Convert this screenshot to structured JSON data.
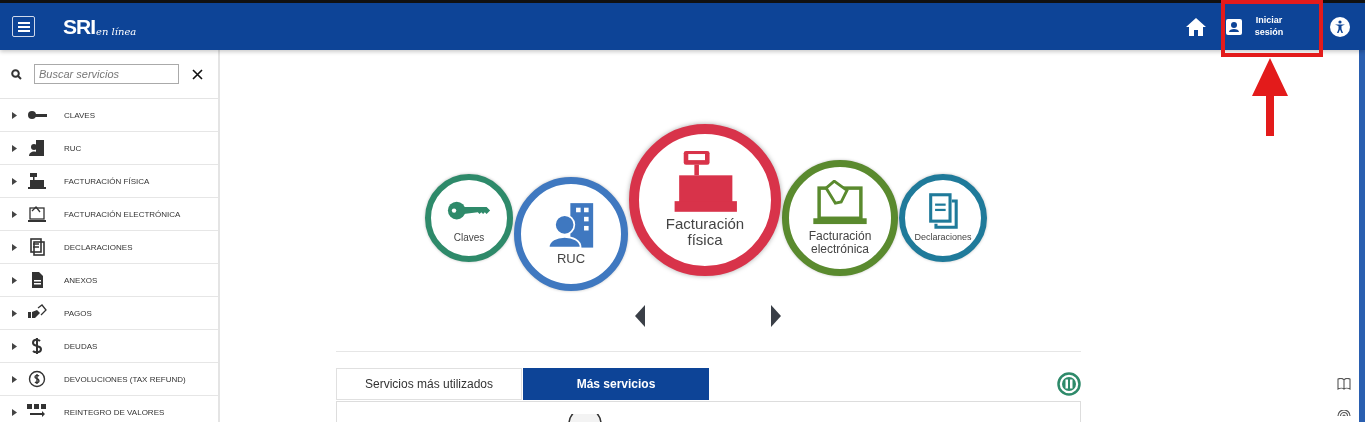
{
  "header": {
    "logo_main": "SRI",
    "logo_sub": "en línea",
    "login_button": "Iniciar sesión"
  },
  "sidebar": {
    "search": {
      "placeholder": "Buscar servicios"
    },
    "items": [
      {
        "label": "CLAVES",
        "kind": "key",
        "expanded": false
      },
      {
        "label": "RUC",
        "kind": "building",
        "expanded": false
      },
      {
        "label": "FACTURACIÓN FÍSICA",
        "kind": "register",
        "expanded": false
      },
      {
        "label": "FACTURACIÓN ELECTRÓNICA",
        "kind": "laptop",
        "expanded": false
      },
      {
        "label": "DECLARACIONES",
        "kind": "documents",
        "expanded": false
      },
      {
        "label": "ANEXOS",
        "kind": "document",
        "expanded": false
      },
      {
        "label": "PAGOS",
        "kind": "hand",
        "expanded": false
      },
      {
        "label": "DEUDAS",
        "kind": "dollar",
        "expanded": false
      },
      {
        "label": "DEVOLUCIONES (TAX REFUND)",
        "kind": "coin",
        "expanded": false
      },
      {
        "label": "REINTEGRO DE VALORES",
        "kind": "transfer",
        "expanded": false
      }
    ]
  },
  "carousel": {
    "items": [
      {
        "label": "Claves",
        "kind": "key",
        "color": "#2e8a6a",
        "selected": false
      },
      {
        "label": "RUC",
        "kind": "building",
        "color": "#3f78c0",
        "selected": false
      },
      {
        "label": "Facturación física",
        "kind": "register",
        "color": "#d8334a",
        "selected": true
      },
      {
        "label": "Facturación electrónica",
        "kind": "laptop",
        "color": "#5a8a2e",
        "selected": false
      },
      {
        "label": "Declaraciones",
        "kind": "documents",
        "color": "#1f7a9a",
        "selected": false
      }
    ]
  },
  "tabs": [
    {
      "label": "Servicios más utilizados",
      "selected": false
    },
    {
      "label": "Más servicios",
      "selected": true
    }
  ]
}
